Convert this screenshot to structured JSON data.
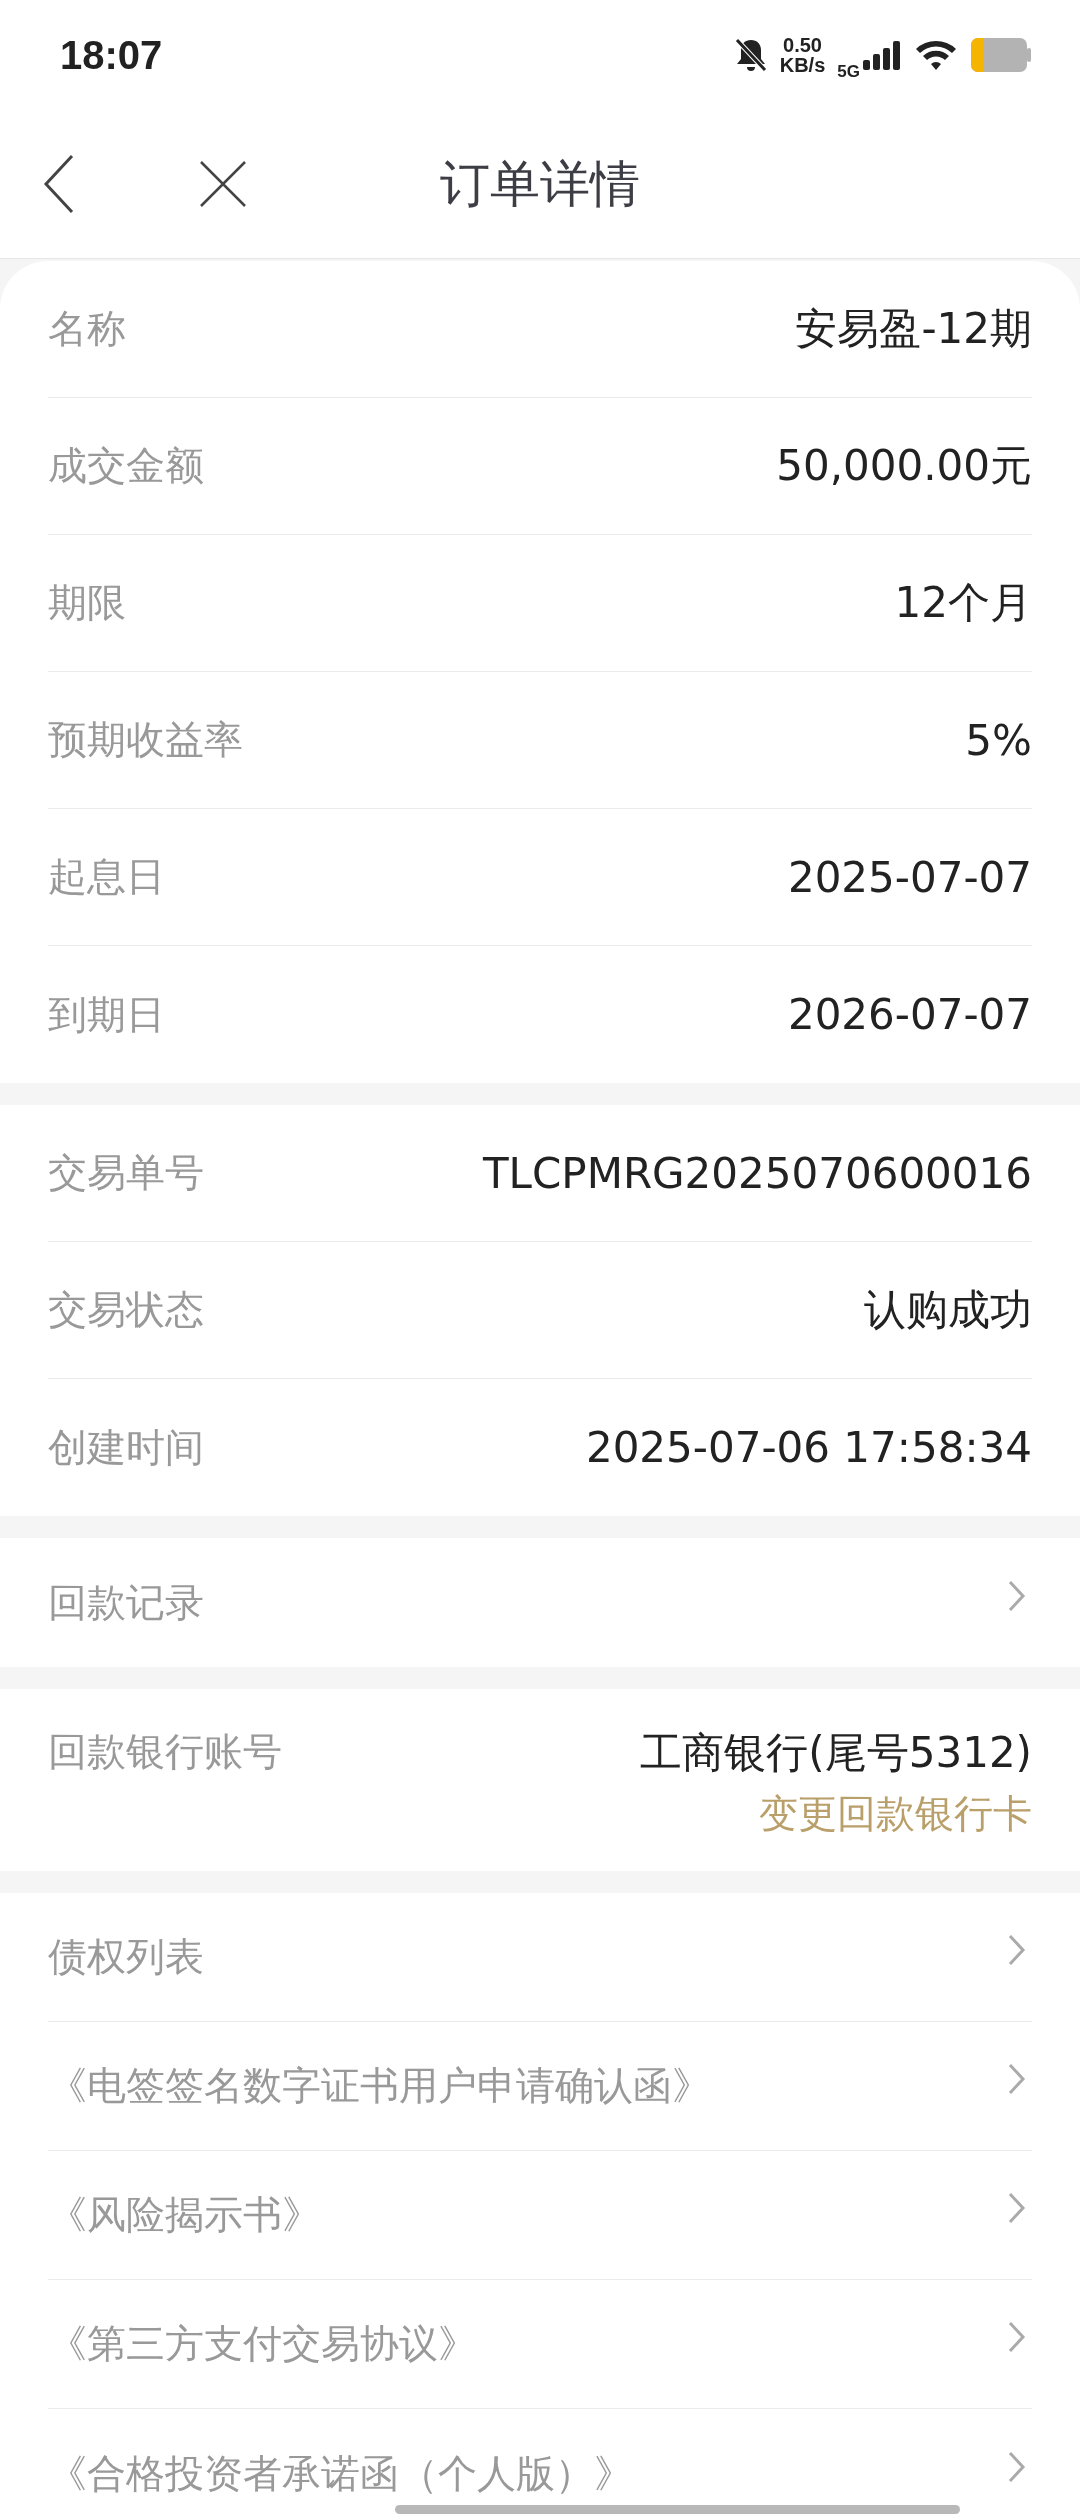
{
  "status_bar": {
    "time": "18:07",
    "net_speed": "0.50",
    "net_unit": "KB/s",
    "network": "5G"
  },
  "nav": {
    "title": "订单详情"
  },
  "sections": [
    {
      "kind": "fields",
      "rows": [
        {
          "label": "名称",
          "value": "安易盈-12期"
        },
        {
          "label": "成交金额",
          "value": "50,000.00元"
        },
        {
          "label": "期限",
          "value": "12个月"
        },
        {
          "label": "预期收益率",
          "value": "5%"
        },
        {
          "label": "起息日",
          "value": "2025-07-07"
        },
        {
          "label": "到期日",
          "value": "2026-07-07"
        }
      ]
    },
    {
      "kind": "fields",
      "rows": [
        {
          "label": "交易单号",
          "value": "TLCPMRG2025070600016"
        },
        {
          "label": "交易状态",
          "value": "认购成功"
        },
        {
          "label": "创建时间",
          "value": "2025-07-06 17:58:34"
        }
      ]
    },
    {
      "kind": "links",
      "rows": [
        {
          "label": "回款记录"
        }
      ]
    },
    {
      "kind": "bank",
      "label": "回款银行账号",
      "value": "工商银行(尾号5312)",
      "action": "变更回款银行卡"
    },
    {
      "kind": "links",
      "rows": [
        {
          "label": "债权列表"
        },
        {
          "label": "《电签签名数字证书用户申请确认函》"
        },
        {
          "label": "《风险揭示书》"
        },
        {
          "label": "《第三方支付交易协议》"
        },
        {
          "label": "《合格投资者承诺函（个人版）》"
        }
      ]
    }
  ]
}
